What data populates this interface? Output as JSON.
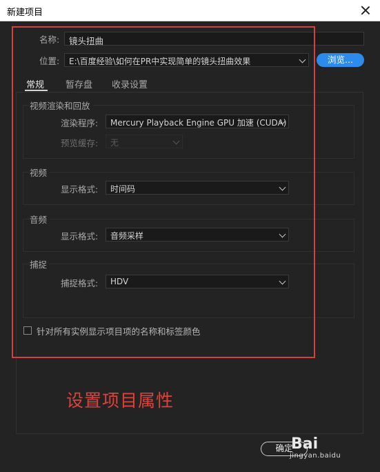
{
  "window": {
    "title": "新建项目"
  },
  "form": {
    "name_label": "名称:",
    "name_value": "镜头扭曲",
    "location_label": "位置:",
    "location_value": "E:\\百度经验\\如何在PR中实现简单的镜头扭曲效果",
    "browse_label": "浏览..."
  },
  "tabs": [
    {
      "label": "常规",
      "active": true
    },
    {
      "label": "暂存盘",
      "active": false
    },
    {
      "label": "收录设置",
      "active": false
    }
  ],
  "groups": {
    "render": {
      "title": "视频渲染和回放",
      "renderer_label": "渲染程序:",
      "renderer_value": "Mercury Playback Engine GPU 加速 (CUDA)",
      "preview_cache_label": "预览缓存:",
      "preview_cache_value": "无"
    },
    "video": {
      "title": "视频",
      "display_format_label": "显示格式:",
      "display_format_value": "时间码"
    },
    "audio": {
      "title": "音频",
      "display_format_label": "显示格式:",
      "display_format_value": "音频采样"
    },
    "capture": {
      "title": "捕捉",
      "capture_format_label": "捕捉格式:",
      "capture_format_value": "HDV"
    }
  },
  "checkbox": {
    "label": "针对所有实例显示项目项的名称和标签颜色",
    "checked": false
  },
  "annotation": {
    "text": "设置项目属性",
    "color": "#e0413b"
  },
  "buttons": {
    "ok_label": "确定"
  },
  "watermark": {
    "big": "Bai",
    "small": "jingyan.baidu"
  },
  "colors": {
    "accent": "#2d8ceb",
    "highlight_box": "#d93f3f"
  }
}
